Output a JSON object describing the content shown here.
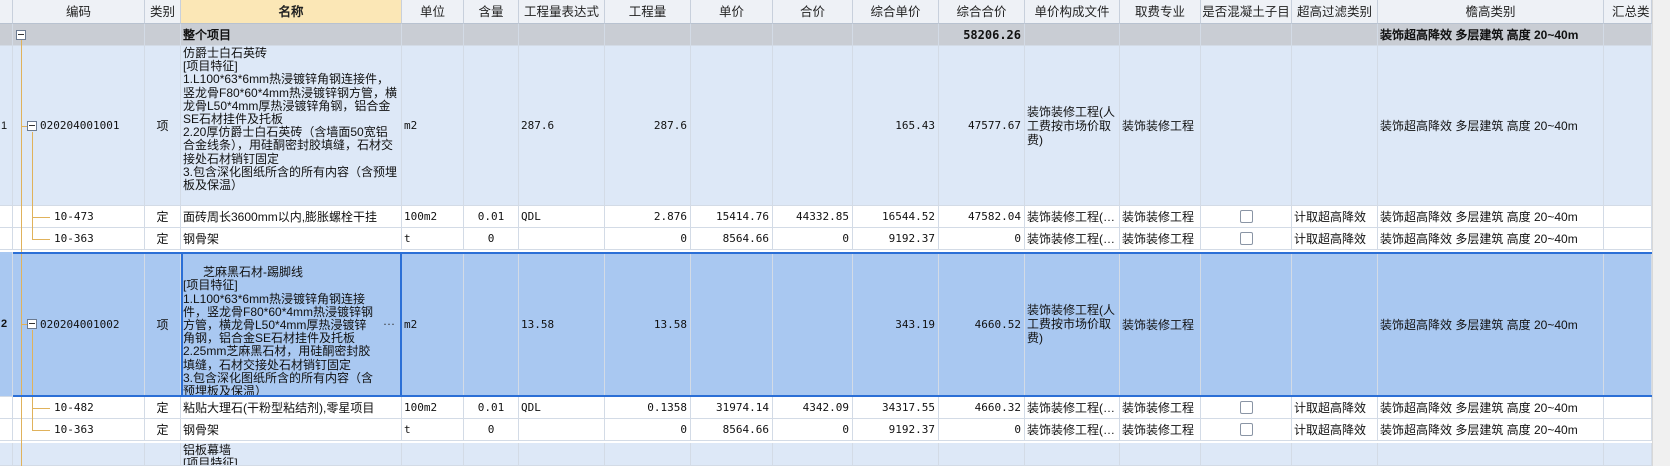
{
  "columns": {
    "index": "",
    "code": "编码",
    "type": "类别",
    "name": "名称",
    "unit": "单位",
    "content": "含量",
    "qty_expr": "工程量表达式",
    "qty": "工程量",
    "unit_price": "单价",
    "total_price": "合价",
    "comp_unit_price": "综合单价",
    "comp_total": "综合合价",
    "price_file": "单价构成文件",
    "fee_major": "取费专业",
    "concrete_sub": "是否混凝土子目",
    "super_filter": "超高过滤类别",
    "eave_type": "檐高类别",
    "summary": "汇总类"
  },
  "whole_project": {
    "label": "整个项目",
    "total": "58206.26",
    "eave_type": "装饰超高降效 多层建筑 高度 20~40m"
  },
  "items": [
    {
      "index": "1",
      "code": "020204001001",
      "type": "项",
      "name": "仿爵士白石英砖\n[项目特征]\n1.L100*63*6mm热浸镀锌角钢连接件，竖龙骨F80*60*4mm热浸镀锌钢方管，横龙骨L50*4mm厚热浸镀锌角钢，铝合金SE石材挂件及托板\n2.20厚仿爵士白石英砖（含墙面50宽铝合金线条），用硅酮密封胶填缝，石材交接处石材销钉固定\n3.包含深化图纸所含的所有内容（含预埋板及保温）",
      "unit": "m2",
      "qty_expr": "287.6",
      "qty": "287.6",
      "comp_unit_price": "165.43",
      "comp_total": "47577.67",
      "price_file": "装饰装修工程(人工费按市场价取费)",
      "fee_major": "装饰装修工程",
      "eave_type": "装饰超高降效 多层建筑 高度 20~40m"
    },
    {
      "code": "10-473",
      "type": "定",
      "name": "面砖周长3600mm以内,膨胀螺栓干挂",
      "unit": "100m2",
      "content": "0.01",
      "qty_expr": "QDL",
      "qty": "2.876",
      "unit_price": "15414.76",
      "total_price": "44332.85",
      "comp_unit_price": "16544.52",
      "comp_total": "47582.04",
      "price_file": "装饰装修工程(…",
      "fee_major": "装饰装修工程",
      "super_filter": "计取超高降效",
      "eave_type": "装饰超高降效 多层建筑 高度 20~40m"
    },
    {
      "code": "10-363",
      "type": "定",
      "name": "钢骨架",
      "unit": "t",
      "content": "0",
      "qty_expr": "",
      "qty": "0",
      "unit_price": "8564.66",
      "total_price": "0",
      "comp_unit_price": "9192.37",
      "comp_total": "0",
      "price_file": "装饰装修工程(…",
      "fee_major": "装饰装修工程",
      "super_filter": "计取超高降效",
      "eave_type": "装饰超高降效 多层建筑 高度 20~40m"
    },
    {
      "index": "2",
      "code": "020204001002",
      "type": "项",
      "name": "芝麻黑石材-踢脚线\n[项目特征]\n1.L100*63*6mm热浸镀锌角钢连接件，竖龙骨F80*60*4mm热浸镀锌钢方管，横龙骨L50*4mm厚热浸镀锌角钢，铝合金SE石材挂件及托板\n2.25mm芝麻黑石材，用硅酮密封胶填缝，石材交接处石材销钉固定\n3.包含深化图纸所含的所有内容（含预埋板及保温）",
      "unit": "m2",
      "qty_expr": "13.58",
      "qty": "13.58",
      "comp_unit_price": "343.19",
      "comp_total": "4660.52",
      "price_file": "装饰装修工程(人工费按市场价取费)",
      "fee_major": "装饰装修工程",
      "eave_type": "装饰超高降效 多层建筑 高度 20~40m",
      "ellipsis": "···"
    },
    {
      "code": "10-482",
      "type": "定",
      "name": "粘贴大理石(干粉型粘结剂),零星项目",
      "unit": "100m2",
      "content": "0.01",
      "qty_expr": "QDL",
      "qty": "0.1358",
      "unit_price": "31974.14",
      "total_price": "4342.09",
      "comp_unit_price": "34317.55",
      "comp_total": "4660.32",
      "price_file": "装饰装修工程(…",
      "fee_major": "装饰装修工程",
      "super_filter": "计取超高降效",
      "eave_type": "装饰超高降效 多层建筑 高度 20~40m"
    },
    {
      "code": "10-363",
      "type": "定",
      "name": "钢骨架",
      "unit": "t",
      "content": "0",
      "qty_expr": "",
      "qty": "0",
      "unit_price": "8564.66",
      "total_price": "0",
      "comp_unit_price": "9192.37",
      "comp_total": "0",
      "price_file": "装饰装修工程(…",
      "fee_major": "装饰装修工程",
      "super_filter": "计取超高降效",
      "eave_type": "装饰超高降效 多层建筑 高度 20~40m"
    },
    {
      "name": "铝板幕墙\n[项目特征]"
    }
  ],
  "colors": {
    "header_bg": "#eef1f6",
    "active_header": "#fbe7b6",
    "project_row": "#c9cdd4",
    "item_row": "#dde8f7",
    "selected_row": "#a9c8f1",
    "tree_line": "#e0b25b",
    "selection_border": "#2b6fd6"
  }
}
